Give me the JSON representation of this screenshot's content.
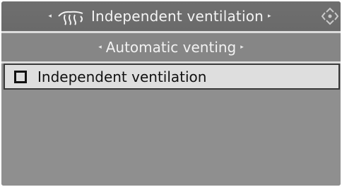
{
  "header": {
    "title": "Independent ventilation",
    "left_arrow": "◂",
    "right_arrow": "▸",
    "icon": "ventilation-icon",
    "controller_icon": "controller-direction-icon"
  },
  "subheader": {
    "title": "Automatic venting",
    "left_arrow": "◂",
    "right_arrow": "▸"
  },
  "menu": {
    "items": [
      {
        "label": "Independent ventilation",
        "checked": false,
        "selected": true
      }
    ]
  },
  "colors": {
    "header_bg": "#6f6f6f",
    "subheader_bg": "#868686",
    "selected_item_bg": "#dedede",
    "content_bg": "#8f8f8f",
    "text_light": "#f4f4f4",
    "text_dark": "#111111"
  }
}
